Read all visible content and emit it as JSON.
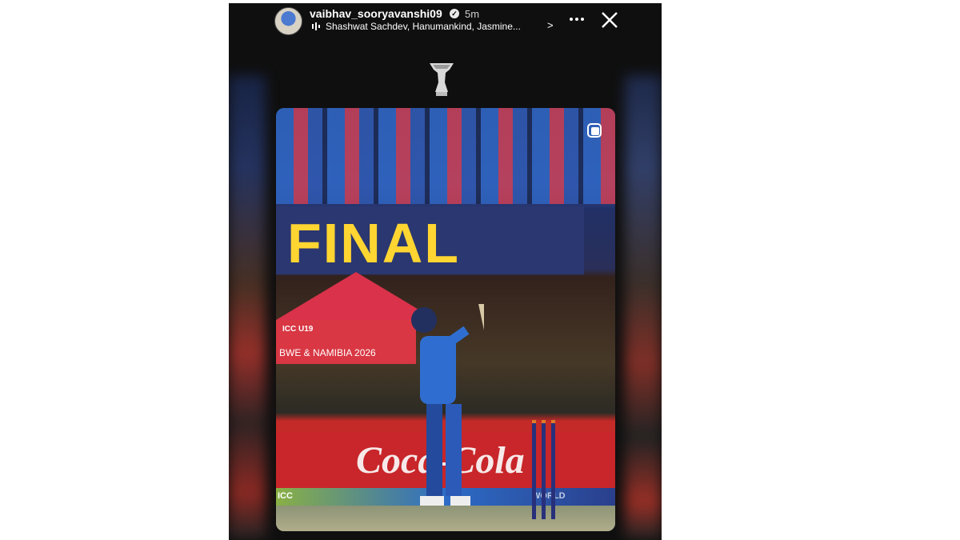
{
  "header": {
    "username": "vaibhav_sooryavanshi09",
    "time": "5m",
    "music_text": "Shashwat Sachdev, Hanumankind, Jasmine...",
    "chevron": ">",
    "verified_glyph": "✓"
  },
  "photo": {
    "banner_text": "FINAL",
    "tent_logo": "ICC U19",
    "tent_text": "BWE & NAMIBIA 2026",
    "ad_text": "Coca-Cola",
    "sub_left": "ICC",
    "sub_right": "WORLD"
  },
  "icons": {
    "audio": "audio-wave-icon",
    "more": "more-dots-icon",
    "close": "close-icon",
    "sticker": "trophy-sticker-icon",
    "corner": "instagram-icon"
  }
}
